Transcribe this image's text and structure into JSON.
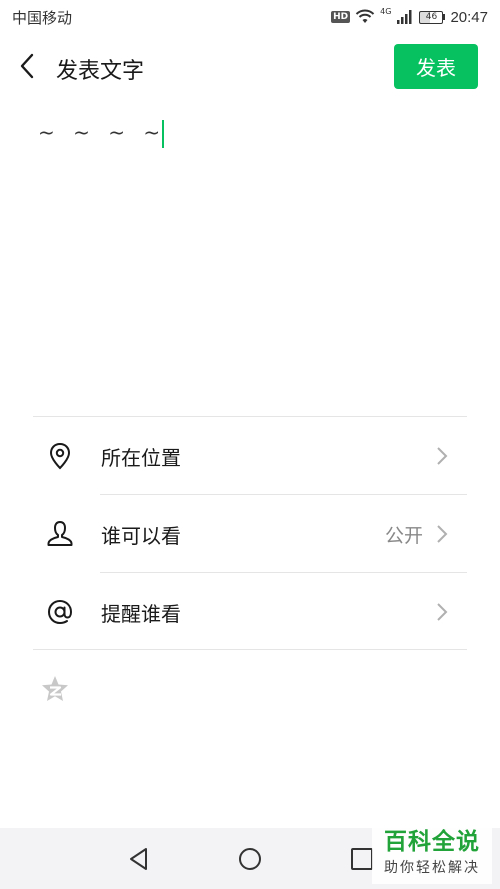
{
  "status_bar": {
    "carrier": "中国移动",
    "hd_badge": "HD",
    "network": "4G",
    "battery": "46",
    "time": "20:47"
  },
  "header": {
    "title": "发表文字",
    "publish_label": "发表"
  },
  "editor": {
    "text": "~ ~ ~ ~"
  },
  "options": [
    {
      "label": "所在位置",
      "value": "",
      "icon": "location-pin-icon"
    },
    {
      "label": "谁可以看",
      "value": "公开",
      "icon": "person-icon"
    },
    {
      "label": "提醒谁看",
      "value": "",
      "icon": "at-sign-icon"
    }
  ],
  "share": {
    "icon": "qzone-star-icon"
  },
  "watermark": {
    "main": "百科全说",
    "sub": "助你轻松解决"
  },
  "colors": {
    "accent": "#07c160",
    "nav_background": "#f3f3f5"
  }
}
